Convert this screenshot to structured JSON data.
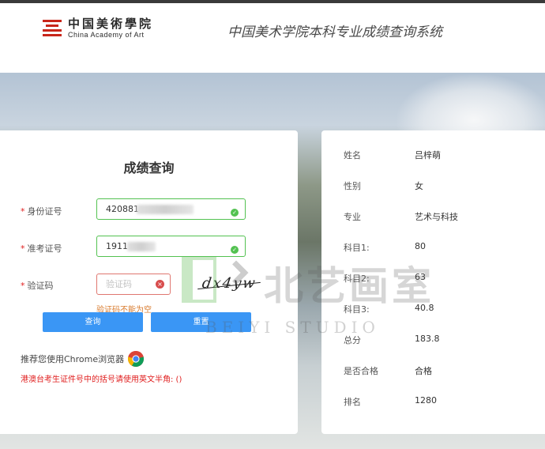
{
  "header": {
    "logo_cn": "中国美術學院",
    "logo_en": "China Academy of Art",
    "site_title": "中国美术学院本科专业成绩查询系统"
  },
  "form": {
    "title": "成绩查询",
    "id_label": "身份证号",
    "id_value": "420881",
    "exam_label": "准考证号",
    "exam_value": "1911",
    "captcha_label": "验证码",
    "captcha_placeholder": "验证码",
    "captcha_image_text": "dx4yw",
    "captcha_error": "验证码不能为空",
    "query_button": "查询",
    "reset_button": "重置",
    "chrome_tip": "推荐您使用Chrome浏览器",
    "hk_tip": "港澳台考生证件号中的括号请使用英文半角: ()"
  },
  "result": {
    "rows": [
      {
        "label": "姓名",
        "value": "吕梓萌"
      },
      {
        "label": "性别",
        "value": "女"
      },
      {
        "label": "专业",
        "value": "艺术与科技"
      },
      {
        "label": "科目1:",
        "value": "80"
      },
      {
        "label": "科目2:",
        "value": "63"
      },
      {
        "label": "科目3:",
        "value": "40.8"
      },
      {
        "label": "总分",
        "value": "183.8"
      },
      {
        "label": "是否合格",
        "value": "合格"
      },
      {
        "label": "排名",
        "value": "1280"
      }
    ]
  },
  "watermark": {
    "cn": "北艺画室",
    "en": "BEIYI STUDIO"
  },
  "colors": {
    "brand_red": "#c8261a",
    "button_blue": "#3a96f5",
    "valid_green": "#53c251",
    "error_red": "#e02020",
    "error_orange": "#d87a2c"
  }
}
